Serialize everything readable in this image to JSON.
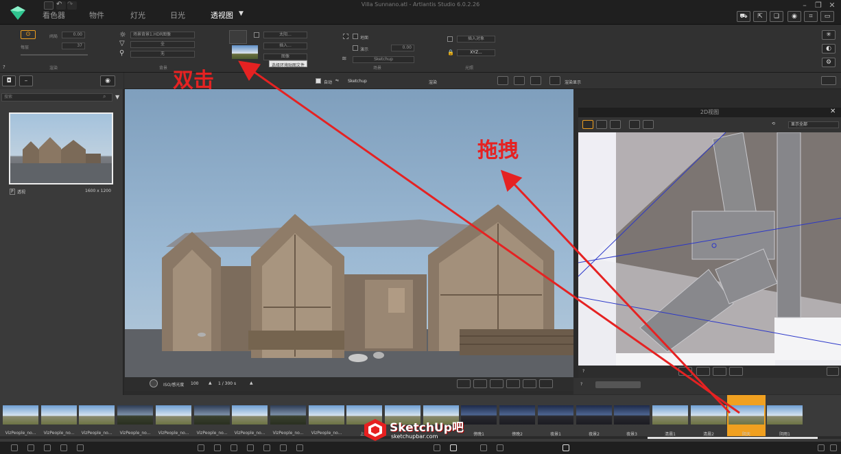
{
  "app": {
    "window_title": "Villa Sunnano.atl - Artlantis Studio 6.0.2.26",
    "tabs": [
      "看色器",
      "物件",
      "灯光",
      "日光",
      "透视图"
    ],
    "active_tab_index": 4
  },
  "ribbon": {
    "render": {
      "label": "渲染",
      "field1_label": "阀局",
      "field1_value": "0.00",
      "field2_label": "每层",
      "field2_value": "37"
    },
    "background": {
      "option1": "场景背景1.HDR图像",
      "option2": "全",
      "option3": "无",
      "label": "背景"
    },
    "env": {
      "field_a": "太阳...",
      "field_b": "插入...",
      "image_select": "图像",
      "tooltip": "选择环境贴图文件"
    },
    "scene": {
      "cb_label": "地面",
      "cb2_label": "演示",
      "value": "0.00",
      "select": "Sketchup",
      "label": "场景"
    },
    "extra": {
      "field": "插入对象",
      "xyz": "XYZ...",
      "label": "光照"
    }
  },
  "left_panel": {
    "search_placeholder": "搜索",
    "thumb_name": "透视",
    "thumb_res": "1600 x 1200"
  },
  "viewbar": {
    "auto_label": "自动",
    "camera_select": "Sketchup",
    "mode_label": "渲染",
    "display_label": "渲染显示"
  },
  "viewport_bottom": {
    "iso_label": "ISO/感光度",
    "iso_value": "100",
    "speed_value": "1 / 300 s"
  },
  "panel_2d": {
    "title": "2D视图",
    "display_select": "显示全部"
  },
  "strip": {
    "items": [
      "VizPeople_no...",
      "VizPeople_no...",
      "VizPeople_no...",
      "VizPeople_no...",
      "VizPeople_no...",
      "VizPeople_no...",
      "VizPeople_no...",
      "VizPeople_no...",
      "VizPeople_no...",
      "上午",
      "",
      "",
      "傍晚1",
      "傍晚2",
      "夜景1",
      "夜景2",
      "夜景3",
      "清晨1",
      "清晨2",
      "阴天",
      "阴雨1"
    ],
    "selected_index": 19
  },
  "annotations": {
    "double_click": "双击",
    "drag": "拖拽"
  },
  "watermark": {
    "brand": "SketchUp吧",
    "url": "sketchupbar.com"
  },
  "colors": {
    "annotation_red": "#e52222",
    "selection_orange": "#f0a020",
    "plan_line_blue": "#2a36c9"
  }
}
